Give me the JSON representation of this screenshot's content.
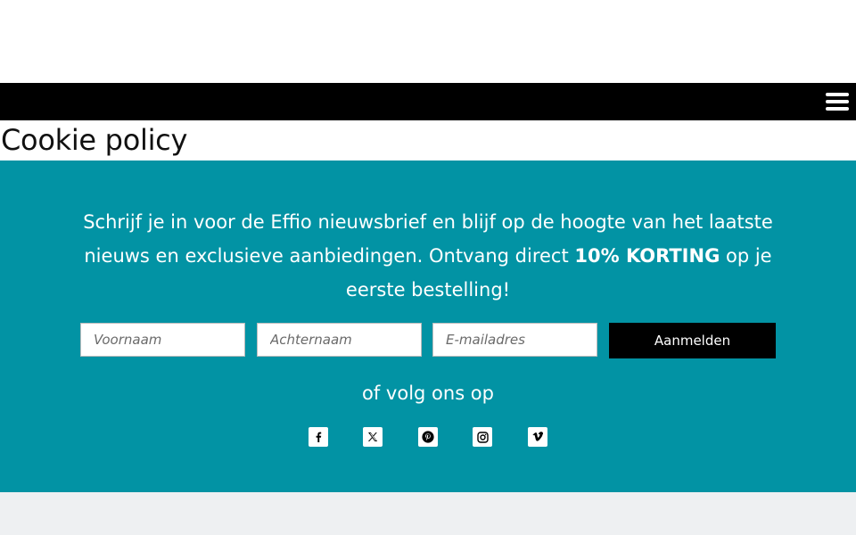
{
  "nav": {
    "menu_icon": "hamburger-menu-icon"
  },
  "page": {
    "title": "Cookie policy"
  },
  "newsletter": {
    "intro_before": "Schrijf je in voor de Effio nieuwsbrief en blijf op de hoogte van het laatste nieuws en exclusieve aanbiedingen. Ontvang direct ",
    "intro_bold": "10% KORTING",
    "intro_after": " op je eerste bestelling!",
    "first_name_placeholder": "Voornaam",
    "last_name_placeholder": "Achternaam",
    "email_placeholder": "E-mailadres",
    "submit_label": "Aanmelden",
    "follow_text": "of volg ons op",
    "background_color": "#0293a4"
  },
  "social": [
    {
      "icon": "facebook-icon"
    },
    {
      "icon": "x-twitter-icon"
    },
    {
      "icon": "pinterest-icon"
    },
    {
      "icon": "instagram-icon"
    },
    {
      "icon": "vimeo-icon"
    }
  ]
}
